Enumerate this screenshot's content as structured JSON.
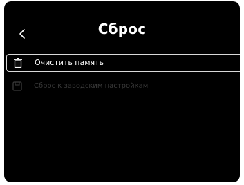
{
  "header": {
    "title": "Сброс",
    "back_icon": "chevron-left-icon"
  },
  "menu": {
    "items": [
      {
        "label": "Очистить память",
        "icon": "trash-icon",
        "selected": true,
        "enabled": true
      },
      {
        "label": "Сброс к заводским настройкам",
        "icon": "factory-reset-icon",
        "selected": false,
        "enabled": false
      }
    ]
  },
  "colors": {
    "background": "#000000",
    "text": "#ffffff",
    "selection_border": "#d8d8d8",
    "disabled_text": "#3a3a3a"
  }
}
